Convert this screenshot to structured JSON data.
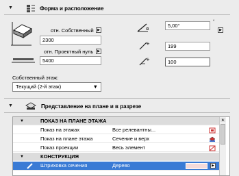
{
  "section1": {
    "title": "Форма и расположение"
  },
  "rel_own": {
    "label": "отн. Собственный",
    "value": "2300"
  },
  "rel_proj": {
    "label": "отн. Проектный нуль",
    "value": "5400"
  },
  "angle": {
    "value": "5,00°"
  },
  "height_field": {
    "value": "199"
  },
  "depth_field": {
    "value": "100"
  },
  "story": {
    "label": "Собственный этаж:",
    "value": "Текущий (2-й этаж)"
  },
  "section2": {
    "title": "Представление на плане и в разрезе"
  },
  "grid": {
    "rows": [
      {
        "type": "section",
        "label": "ПОКАЗ НА ПЛАНЕ ЭТАЖА"
      },
      {
        "type": "item",
        "name": "Показ на этажах",
        "value": "Все релевантны..."
      },
      {
        "type": "item",
        "name": "Показ на плане этажа",
        "value": "Сечение и верх"
      },
      {
        "type": "item",
        "name": "Показ проекции",
        "value": "Весь элемент"
      },
      {
        "type": "section",
        "label": "КОНСТРУКЦИЯ"
      },
      {
        "type": "selected",
        "name": "Штриховка сечения",
        "value": "Дерево"
      }
    ]
  },
  "colors": {
    "selection": "#3a7bd5",
    "panel": "#ececec"
  }
}
